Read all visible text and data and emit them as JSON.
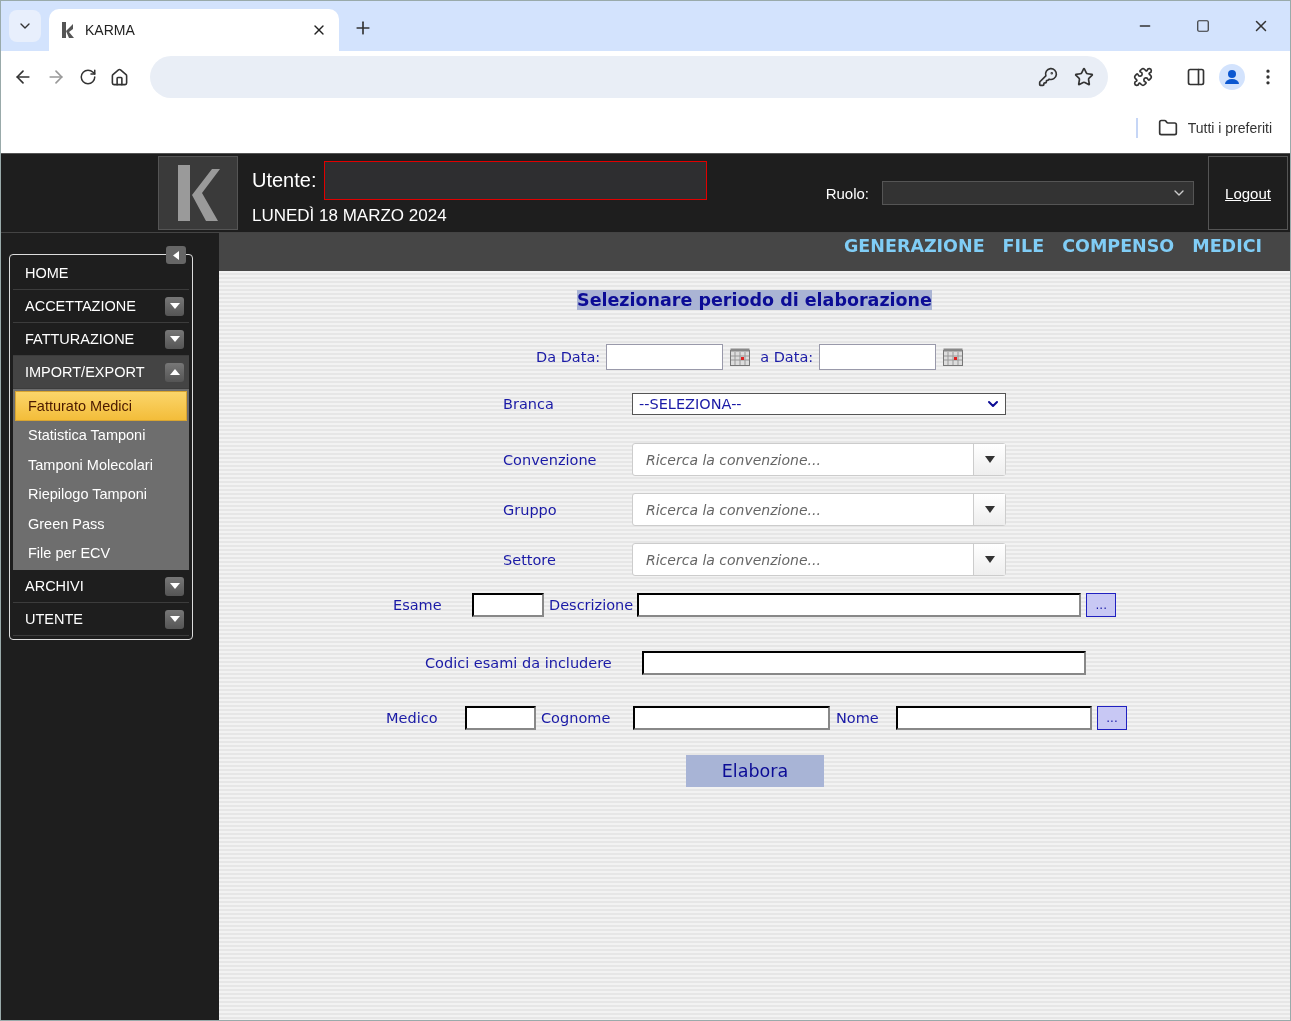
{
  "browser": {
    "tab_title": "KARMA",
    "bookmarks": "Tutti i preferiti"
  },
  "header": {
    "user_label": "Utente:",
    "date": "LUNEDÌ 18 MARZO 2024",
    "role_label": "Ruolo:",
    "logout": "Logout"
  },
  "nav": [
    "GENERAZIONE",
    "FILE",
    "COMPENSO",
    "MEDICI"
  ],
  "sidebar": {
    "items": [
      {
        "label": "HOME",
        "kind": "link"
      },
      {
        "label": "ACCETTAZIONE",
        "kind": "group",
        "expanded": false
      },
      {
        "label": "FATTURAZIONE",
        "kind": "group",
        "expanded": false
      },
      {
        "label": "IMPORT/EXPORT",
        "kind": "group",
        "expanded": true,
        "children": [
          {
            "label": "Fatturato Medici",
            "selected": true
          },
          {
            "label": "Statistica Tamponi",
            "selected": false
          },
          {
            "label": "Tamponi Molecolari",
            "selected": false
          },
          {
            "label": "Riepilogo Tamponi",
            "selected": false
          },
          {
            "label": "Green Pass",
            "selected": false
          },
          {
            "label": "File per ECV",
            "selected": false
          }
        ]
      },
      {
        "label": "ARCHIVI",
        "kind": "group",
        "expanded": false
      },
      {
        "label": "UTENTE",
        "kind": "group",
        "expanded": false
      }
    ]
  },
  "form": {
    "title": "Selezionare periodo di elaborazione",
    "from_label": "Da Data:",
    "to_label": "a Data:",
    "branca": {
      "label": "Branca",
      "value": "--SELEZIONA--"
    },
    "combos": [
      {
        "label": "Convenzione",
        "placeholder": "Ricerca la convenzione..."
      },
      {
        "label": "Gruppo",
        "placeholder": "Ricerca la convenzione..."
      },
      {
        "label": "Settore",
        "placeholder": "Ricerca la convenzione..."
      }
    ],
    "esame_label": "Esame",
    "descrizione_label": "Descrizione",
    "esame_browse": "...",
    "codici_label": "Codici esami da includere",
    "medico_label": "Medico",
    "cognome_label": "Cognome",
    "nome_label": "Nome",
    "medico_browse": "...",
    "submit": "Elabora"
  }
}
